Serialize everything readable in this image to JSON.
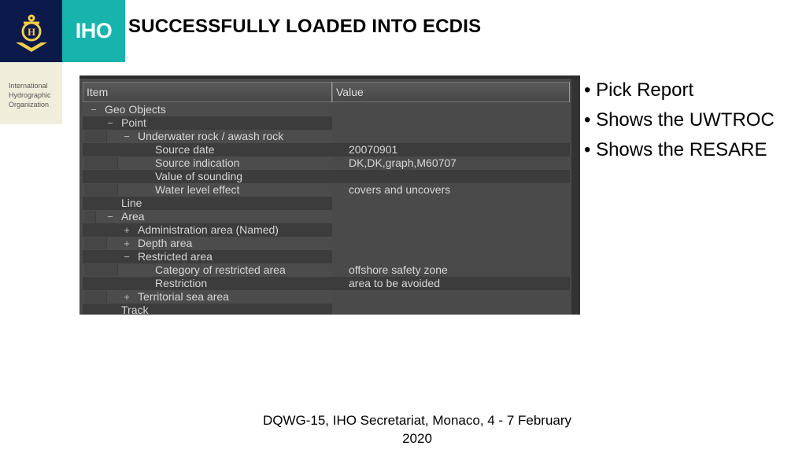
{
  "logo": {
    "emblem": "anchor-emblem-icon",
    "short_name": "IHO",
    "org_lines": [
      "International",
      "Hydrographic",
      "Organization"
    ],
    "colors": {
      "navy": "#0b1a4a",
      "teal": "#17b4ad",
      "cream": "#efeedb",
      "gold": "#f2cf4a"
    }
  },
  "slide": {
    "title": "SUCCESSFULLY LOADED INTO ECDIS"
  },
  "pick_report": {
    "columns": [
      "Item",
      "Value"
    ],
    "rows": [
      {
        "label": "Geo Objects",
        "level": 0,
        "expander": "−",
        "value": ""
      },
      {
        "label": "Point",
        "level": 1,
        "expander": "−",
        "value": ""
      },
      {
        "label": "Underwater rock / awash rock",
        "level": 2,
        "expander": "−",
        "value": ""
      },
      {
        "label": "Source date",
        "level": 3,
        "expander": "",
        "value": "20070901"
      },
      {
        "label": "Source indication",
        "level": 3,
        "expander": "",
        "value": "DK,DK,graph,M60707"
      },
      {
        "label": "Value of sounding",
        "level": 3,
        "expander": "",
        "value": ""
      },
      {
        "label": "Water level effect",
        "level": 3,
        "expander": "",
        "value": "covers and uncovers"
      },
      {
        "label": "Line",
        "level": 1,
        "expander": "",
        "value": ""
      },
      {
        "label": "Area",
        "level": 1,
        "expander": "−",
        "value": ""
      },
      {
        "label": "Administration area (Named)",
        "level": 2,
        "expander": "+",
        "value": ""
      },
      {
        "label": "Depth area",
        "level": 2,
        "expander": "+",
        "value": ""
      },
      {
        "label": "Restricted area",
        "level": 2,
        "expander": "−",
        "value": ""
      },
      {
        "label": "Category of restricted area",
        "level": 3,
        "expander": "",
        "value": "offshore safety zone"
      },
      {
        "label": "Restriction",
        "level": 3,
        "expander": "",
        "value": "area to be avoided"
      },
      {
        "label": "Territorial sea area",
        "level": 2,
        "expander": "+",
        "value": ""
      },
      {
        "label": "Track",
        "level": 1,
        "expander": "",
        "value": ""
      }
    ]
  },
  "bullets": [
    "Pick Report",
    "Shows the UWTROC",
    "Shows the RESARE"
  ],
  "footer": {
    "line1": "DQWG-15, IHO Secretariat, Monaco, 4 - 7 February",
    "line2": "2020"
  }
}
